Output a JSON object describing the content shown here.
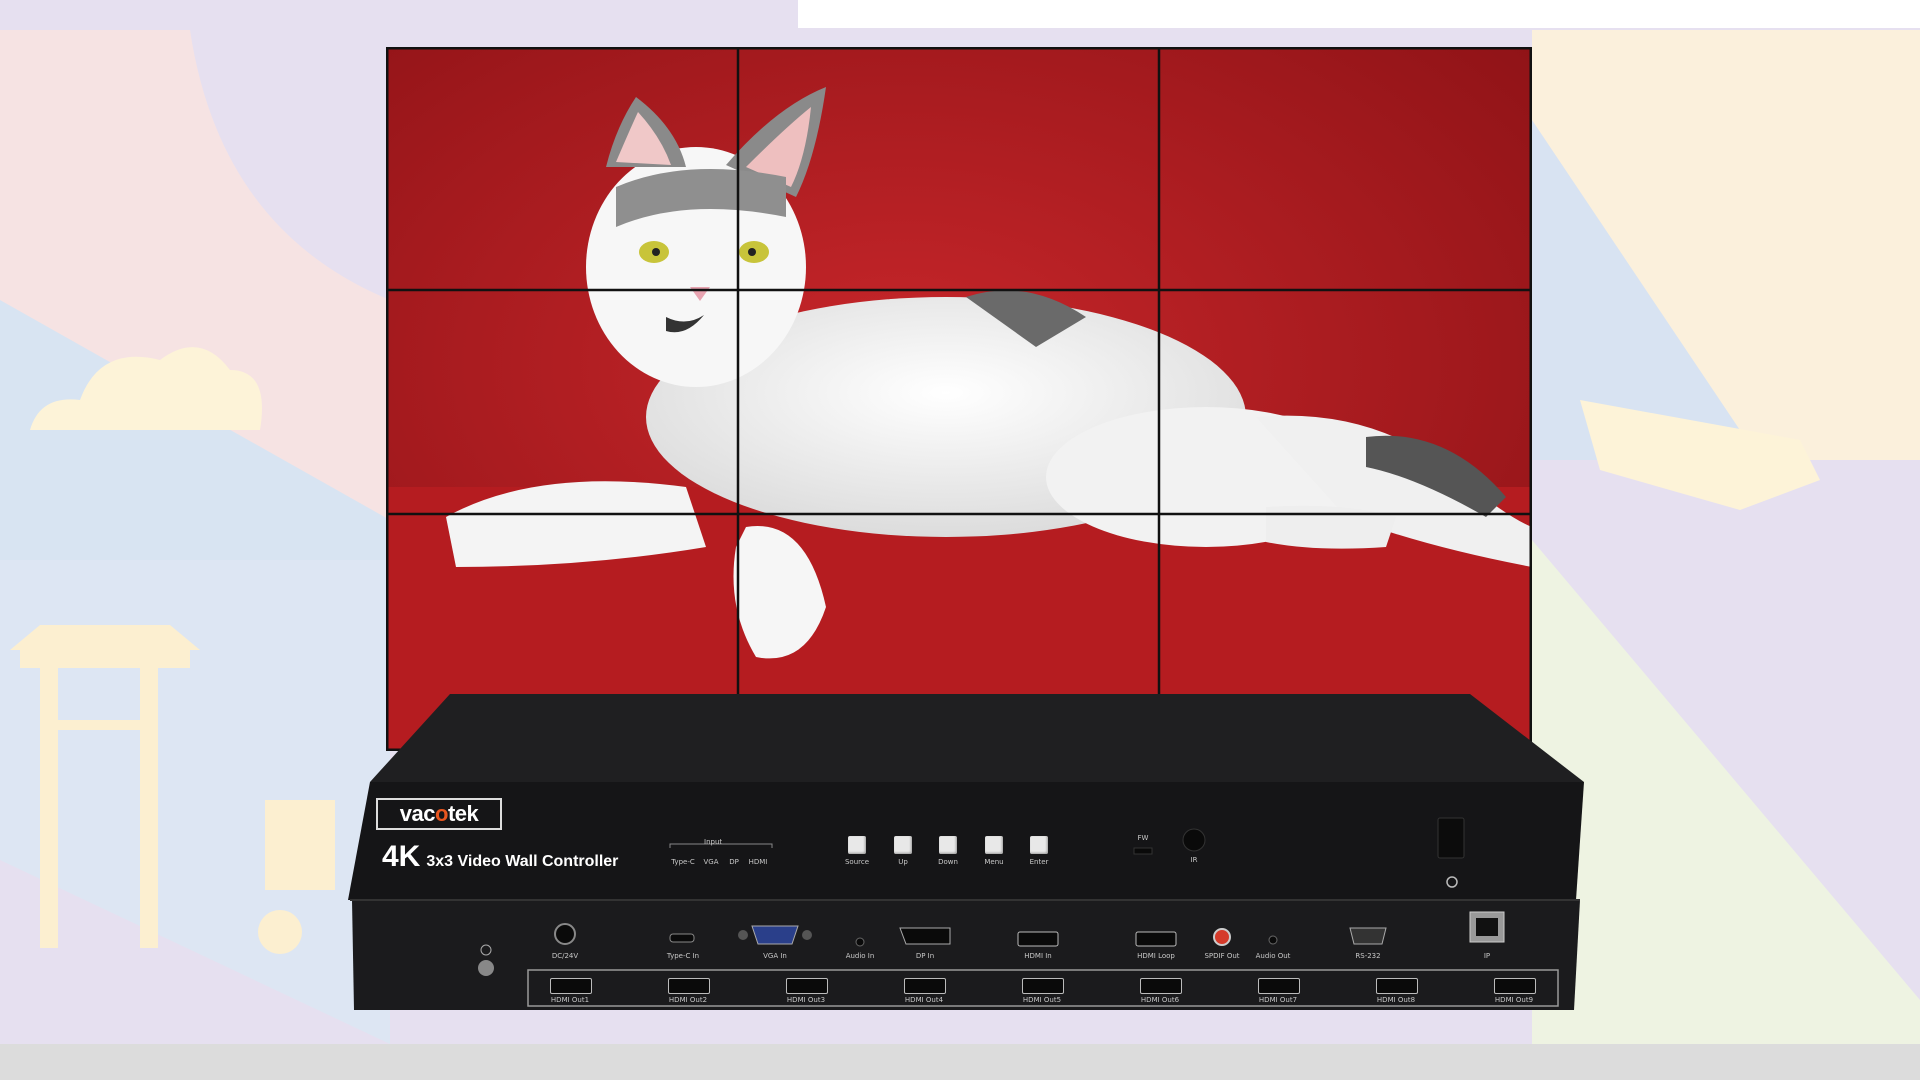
{
  "product": {
    "brand_prefix": "vac",
    "brand_o": "o",
    "brand_suffix": "tek",
    "model_big": "4K",
    "model_small": "3x3 Video Wall Controller"
  },
  "front_panel": {
    "input_group_label": "Input",
    "input_labels": [
      "Type-C",
      "VGA",
      "DP",
      "HDMI"
    ],
    "button_labels": [
      "Source",
      "Up",
      "Down",
      "Menu",
      "Enter"
    ],
    "fw_label": "FW",
    "ir_label": "IR"
  },
  "rear_panel": {
    "top_ports": [
      "DC/24V",
      "Type-C In",
      "VGA In",
      "Audio In",
      "DP In",
      "HDMI In",
      "HDMI Loop",
      "SPDIF Out",
      "Audio Out",
      "RS-232",
      "IP"
    ],
    "hdmi_outputs": [
      "HDMI Out1",
      "HDMI Out2",
      "HDMI Out3",
      "HDMI Out4",
      "HDMI Out5",
      "HDMI Out6",
      "HDMI Out7",
      "HDMI Out8",
      "HDMI Out9"
    ]
  },
  "colors": {
    "wall_red": "#b81c1f",
    "device_black": "#1c1c1e",
    "logo_accent": "#e8561f"
  }
}
